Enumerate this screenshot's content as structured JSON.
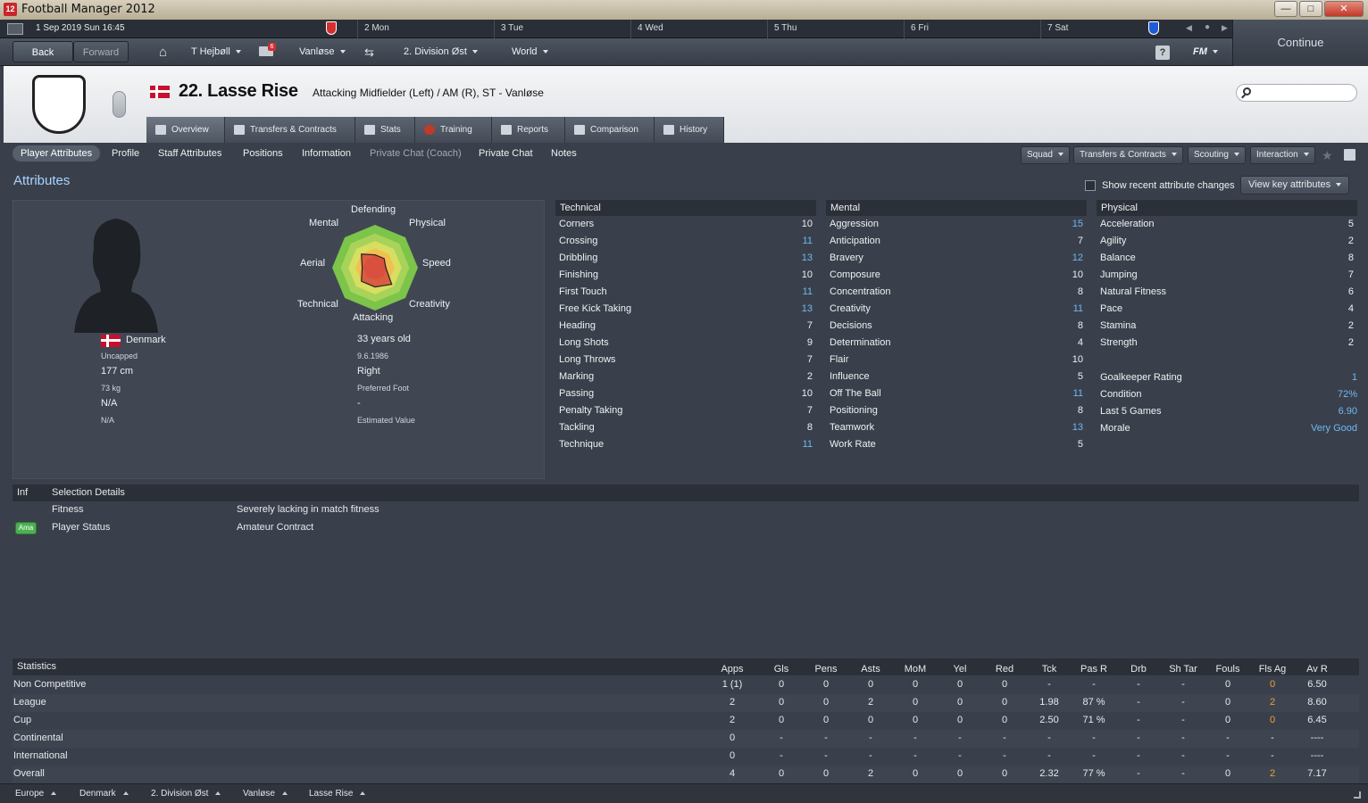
{
  "window": {
    "title": "Football Manager 2012",
    "app_badge": "12",
    "min": "—",
    "max": "□",
    "close": "✕"
  },
  "calendar": {
    "date": "1 Sep 2019  Sun  16:45",
    "days": [
      "2  Mon",
      "3  Tue",
      "4  Wed",
      "5  Thu",
      "6  Fri",
      "7  Sat"
    ]
  },
  "nav": {
    "back": "Back",
    "forward": "Forward",
    "manager": "T Hejbøll",
    "club": "Vanløse",
    "division": "2. Division Øst",
    "world": "World",
    "help": "?",
    "fm": "FM",
    "continue": "Continue",
    "mail_count": "6"
  },
  "player": {
    "number_name": "22. Lasse Rise",
    "positions": "Attacking Midfielder (Left) / AM (R), ST - Vanløse"
  },
  "tabs": [
    "Overview",
    "Transfers & Contracts",
    "Stats",
    "Training",
    "Reports",
    "Comparison",
    "History"
  ],
  "subtabs": [
    "Player Attributes",
    "Profile",
    "Staff Attributes",
    "Positions",
    "Information",
    "Private Chat (Coach)",
    "Private Chat",
    "Notes"
  ],
  "right_buttons": [
    "Squad",
    "Transfers & Contracts",
    "Scouting",
    "Interaction"
  ],
  "section_title": "Attributes",
  "recent_changes": "Show recent attribute changes",
  "view_key": "View key attributes",
  "radar": {
    "labels": [
      "Defending",
      "Physical",
      "Speed",
      "Creativity",
      "Attacking",
      "Technical",
      "Aerial",
      "Mental"
    ],
    "values": [
      0.3,
      0.3,
      0.25,
      0.55,
      0.45,
      0.45,
      0.3,
      0.45
    ]
  },
  "info": {
    "nation": "Denmark",
    "caps": "Uncapped",
    "height": "177 cm",
    "weight": "73 kg",
    "na1": "N/A",
    "na2": "N/A",
    "age": "33 years old",
    "dob": "9.6.1986",
    "foot": "Right",
    "foot_lbl": "Preferred Foot",
    "value": "-",
    "value_lbl": "Estimated Value"
  },
  "technical": {
    "title": "Technical",
    "rows": [
      [
        "Corners",
        "10"
      ],
      [
        "Crossing",
        "11"
      ],
      [
        "Dribbling",
        "13"
      ],
      [
        "Finishing",
        "10"
      ],
      [
        "First Touch",
        "11"
      ],
      [
        "Free Kick Taking",
        "13"
      ],
      [
        "Heading",
        "7"
      ],
      [
        "Long Shots",
        "9"
      ],
      [
        "Long Throws",
        "7"
      ],
      [
        "Marking",
        "2"
      ],
      [
        "Passing",
        "10"
      ],
      [
        "Penalty Taking",
        "7"
      ],
      [
        "Tackling",
        "8"
      ],
      [
        "Technique",
        "11"
      ]
    ]
  },
  "mental": {
    "title": "Mental",
    "rows": [
      [
        "Aggression",
        "15"
      ],
      [
        "Anticipation",
        "7"
      ],
      [
        "Bravery",
        "12"
      ],
      [
        "Composure",
        "10"
      ],
      [
        "Concentration",
        "8"
      ],
      [
        "Creativity",
        "11"
      ],
      [
        "Decisions",
        "8"
      ],
      [
        "Determination",
        "4"
      ],
      [
        "Flair",
        "10"
      ],
      [
        "Influence",
        "5"
      ],
      [
        "Off The Ball",
        "11"
      ],
      [
        "Positioning",
        "8"
      ],
      [
        "Teamwork",
        "13"
      ],
      [
        "Work Rate",
        "5"
      ]
    ]
  },
  "physical": {
    "title": "Physical",
    "rows": [
      [
        "Acceleration",
        "5"
      ],
      [
        "Agility",
        "2"
      ],
      [
        "Balance",
        "8"
      ],
      [
        "Jumping",
        "7"
      ],
      [
        "Natural Fitness",
        "6"
      ],
      [
        "Pace",
        "4"
      ],
      [
        "Stamina",
        "2"
      ],
      [
        "Strength",
        "2"
      ]
    ],
    "extra": [
      [
        "Goalkeeper Rating",
        "1"
      ],
      [
        "Condition",
        "72%"
      ],
      [
        "Last 5 Games",
        "6.90"
      ],
      [
        "Morale",
        "Very Good"
      ]
    ]
  },
  "selection": {
    "inf": "Inf",
    "title": "Selection Details",
    "rows": [
      [
        "",
        "Fitness",
        "Severely lacking in match fitness"
      ],
      [
        "Ama",
        "Player Status",
        "Amateur Contract"
      ]
    ]
  },
  "stats": {
    "title": "Statistics",
    "cols": [
      "Apps",
      "Gls",
      "Pens",
      "Asts",
      "MoM",
      "Yel",
      "Red",
      "Tck",
      "Pas R",
      "Drb",
      "Sh Tar",
      "Fouls",
      "Fls Ag",
      "Av R"
    ],
    "rows": [
      [
        "Non Competitive",
        "1 (1)",
        "0",
        "0",
        "0",
        "0",
        "0",
        "0",
        "-",
        "-",
        "-",
        "-",
        "0",
        "0",
        "6.50"
      ],
      [
        "League",
        "2",
        "0",
        "0",
        "2",
        "0",
        "0",
        "0",
        "1.98",
        "87 %",
        "-",
        "-",
        "0",
        "2",
        "8.60"
      ],
      [
        "Cup",
        "2",
        "0",
        "0",
        "0",
        "0",
        "0",
        "0",
        "2.50",
        "71 %",
        "-",
        "-",
        "0",
        "0",
        "6.45"
      ],
      [
        "Continental",
        "0",
        "-",
        "-",
        "-",
        "-",
        "-",
        "-",
        "-",
        "-",
        "-",
        "-",
        "-",
        "-",
        "----"
      ],
      [
        "International",
        "0",
        "-",
        "-",
        "-",
        "-",
        "-",
        "-",
        "-",
        "-",
        "-",
        "-",
        "-",
        "-",
        "----"
      ],
      [
        "Overall",
        "4",
        "0",
        "0",
        "2",
        "0",
        "0",
        "0",
        "2.32",
        "77 %",
        "-",
        "-",
        "0",
        "2",
        "7.17"
      ]
    ]
  },
  "breadcrumb": [
    "Europe",
    "Denmark",
    "2. Division Øst",
    "Vanløse",
    "Lasse Rise"
  ]
}
